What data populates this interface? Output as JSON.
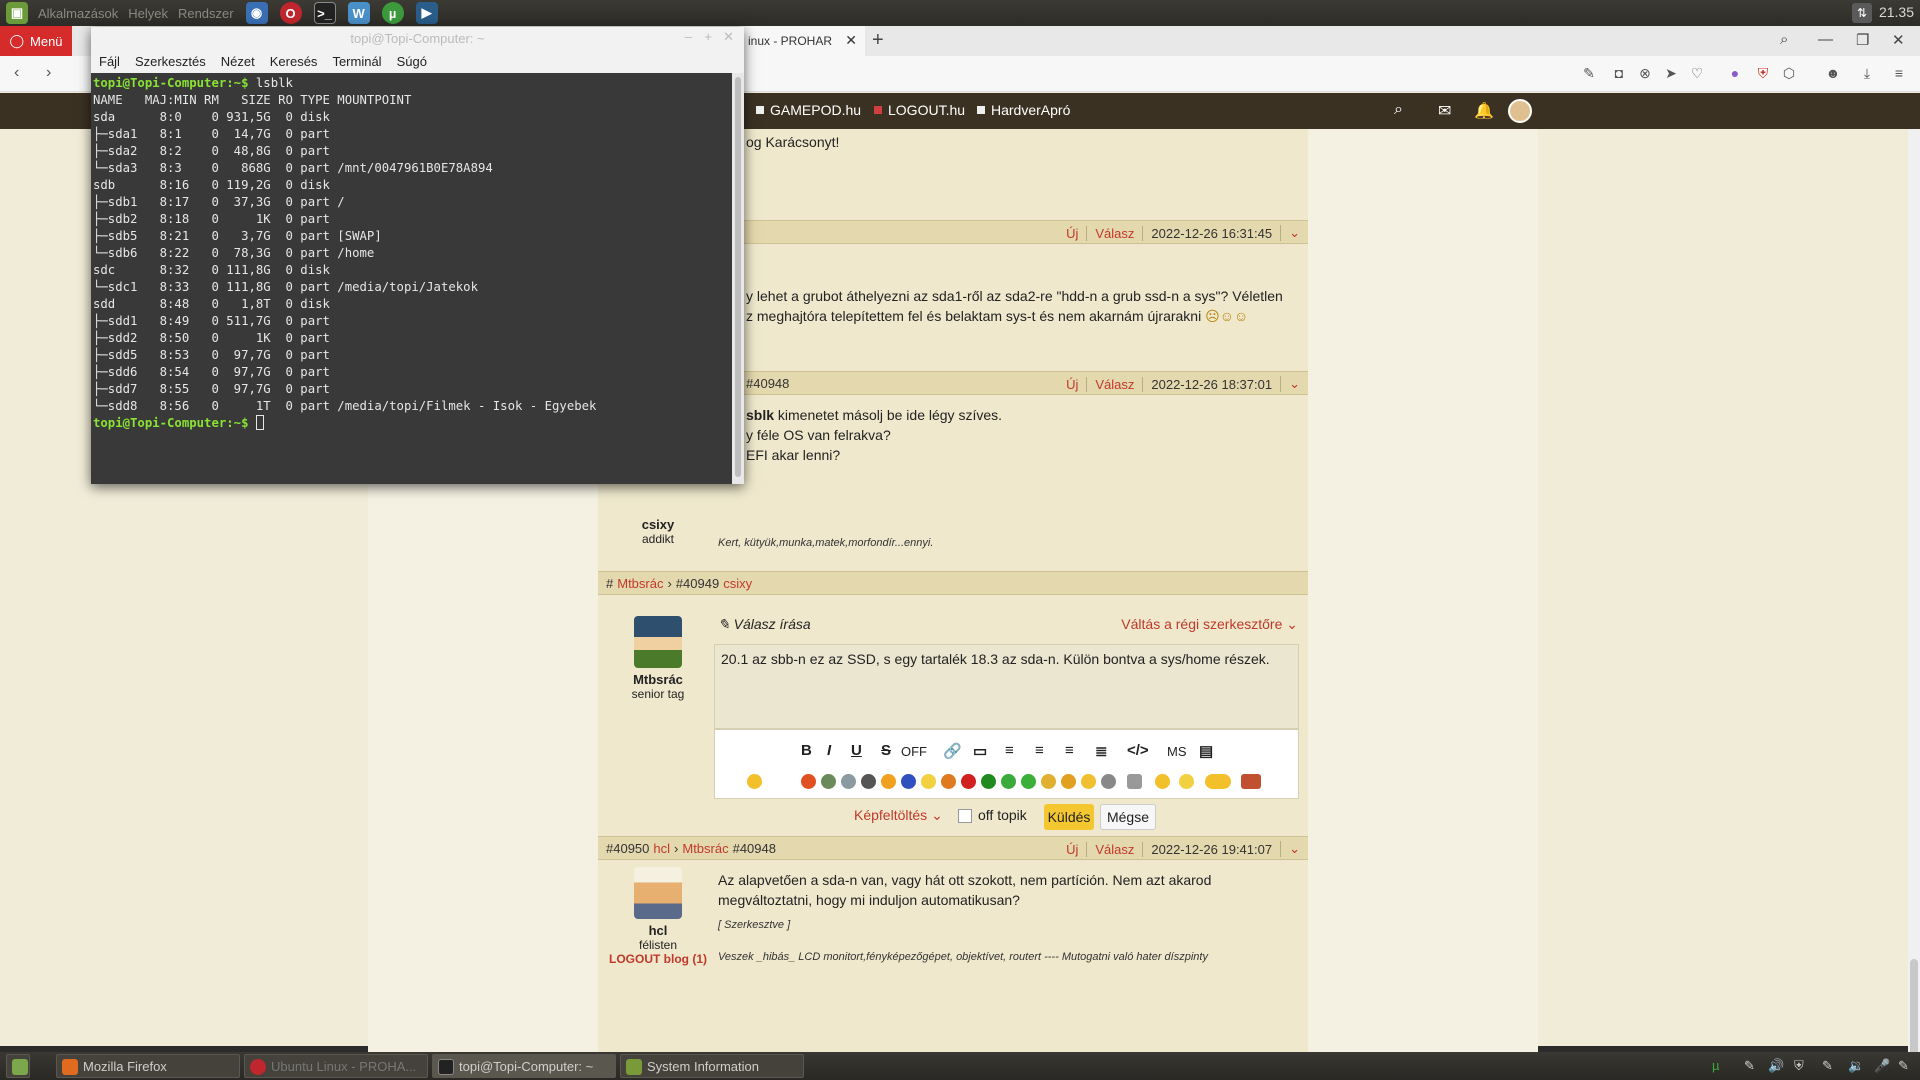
{
  "system_panel": {
    "menu_text": [
      "Alkalmazások",
      "Helyek",
      "Rendszer"
    ],
    "clock": "21.35"
  },
  "browser": {
    "menu_label": "Menü",
    "active_tab_title": "inux - PROHAR",
    "bookmarks": [
      "GAMEPOD.hu",
      "LOGOUT.hu",
      "HardverApró"
    ]
  },
  "terminal": {
    "title": "topi@Topi-Computer: ~",
    "menu": [
      "Fájl",
      "Szerkesztés",
      "Nézet",
      "Keresés",
      "Terminál",
      "Súgó"
    ],
    "prompt": "topi@Topi-Computer:~$",
    "command": " lsblk",
    "output": [
      "NAME   MAJ:MIN RM   SIZE RO TYPE MOUNTPOINT",
      "sda      8:0    0 931,5G  0 disk ",
      "├─sda1   8:1    0  14,7G  0 part ",
      "├─sda2   8:2    0  48,8G  0 part ",
      "└─sda3   8:3    0   868G  0 part /mnt/0047961B0E78A894",
      "sdb      8:16   0 119,2G  0 disk ",
      "├─sdb1   8:17   0  37,3G  0 part /",
      "├─sdb2   8:18   0     1K  0 part ",
      "├─sdb5   8:21   0   3,7G  0 part [SWAP]",
      "└─sdb6   8:22   0  78,3G  0 part /home",
      "sdc      8:32   0 111,8G  0 disk ",
      "└─sdc1   8:33   0 111,8G  0 part /media/topi/Jatekok",
      "sdd      8:48   0   1,8T  0 disk ",
      "├─sdd1   8:49   0 511,7G  0 part ",
      "├─sdd2   8:50   0     1K  0 part ",
      "├─sdd5   8:53   0  97,7G  0 part ",
      "├─sdd6   8:54   0  97,7G  0 part ",
      "├─sdd7   8:55   0  97,7G  0 part ",
      "└─sdd8   8:56   0     1T  0 part /media/topi/Filmek - Isok - Egyebek"
    ]
  },
  "forum": {
    "post1_fragment": "og Karácsonyt!",
    "post2": {
      "new": "Új",
      "reply": "Válasz",
      "date": "2022-12-26 16:31:45",
      "text1": "y lehet a grubot áthelyezni az sda1-ről az sda2-re \"hdd-n a grub ssd-n a sys\"? Véletlen",
      "text2": "z meghajtóra telepítettem fel és belaktam sys-t és nem akarnám újrarakni"
    },
    "post3": {
      "id": "#40948",
      "new": "Új",
      "reply": "Válasz",
      "date": "2022-12-26 18:37:01",
      "bold": "sblk",
      "line1": " kimenetet másolj be ide légy szíves.",
      "line2": "y féle OS van felrakva?",
      "line3": "EFI akar lenni?",
      "user": "csixy",
      "rank": "addikt",
      "signature": "Kert, kütyük,munka,matek,morfondír...ennyi."
    },
    "reply": {
      "hash": "#",
      "from": "Mtbsrác",
      "to_id": "#40949",
      "to_user": "csixy",
      "title": "Válasz írása",
      "switch": "Váltás a régi szerkesztőre",
      "user": "Mtbsrác",
      "rank": "senior tag",
      "text": "20.1 az sbb-n ez az SSD, s egy tartalék 18.3 az sda-n. Külön bontva a sys/home részek.",
      "toolbar_off": "OFF",
      "toolbar_ms": "MS",
      "upload": "Képfeltöltés",
      "offtopic": "off topik",
      "send": "Küldés",
      "cancel": "Mégse"
    },
    "post4": {
      "id": "#40950",
      "user_link": "hcl",
      "to": "Mtbsrác",
      "to_id": "#40948",
      "new": "Új",
      "reply": "Válasz",
      "date": "2022-12-26 19:41:07",
      "line1": "Az alapvetően a sda-n van, vagy hát ott szokott, nem partíción. Nem azt akarod",
      "line2": "megváltoztatni, hogy mi induljon automatikusan?",
      "edited": "[ Szerkesztve ]",
      "signature": "Veszek _hibás_ LCD monitort,fényképezőgépet, objektívet, routert ---- Mutogatni való hater díszpinty",
      "user": "hcl",
      "rank": "félisten",
      "blog": "LOGOUT blog (1)"
    }
  },
  "taskbar": {
    "items": [
      "Mozilla Firefox",
      "Ubuntu Linux - PROHA...",
      "topi@Topi-Computer: ~",
      "System Information"
    ]
  },
  "colors": {
    "accent_red": "#c0392b",
    "menu_red": "#d52b2b",
    "header_brown": "#3b3123",
    "send_yellow": "#f4c630"
  }
}
